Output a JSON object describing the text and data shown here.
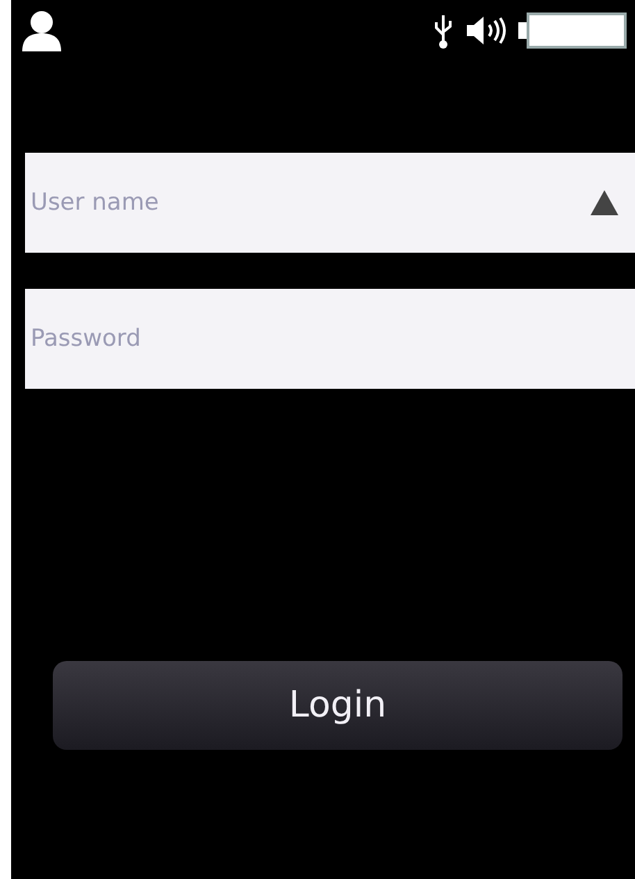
{
  "fields": [
    {
      "kind": "dropdown",
      "placeholder": "User name"
    },
    {
      "kind": "password",
      "placeholder": "Password"
    }
  ],
  "login_button": {
    "label": "Login"
  }
}
